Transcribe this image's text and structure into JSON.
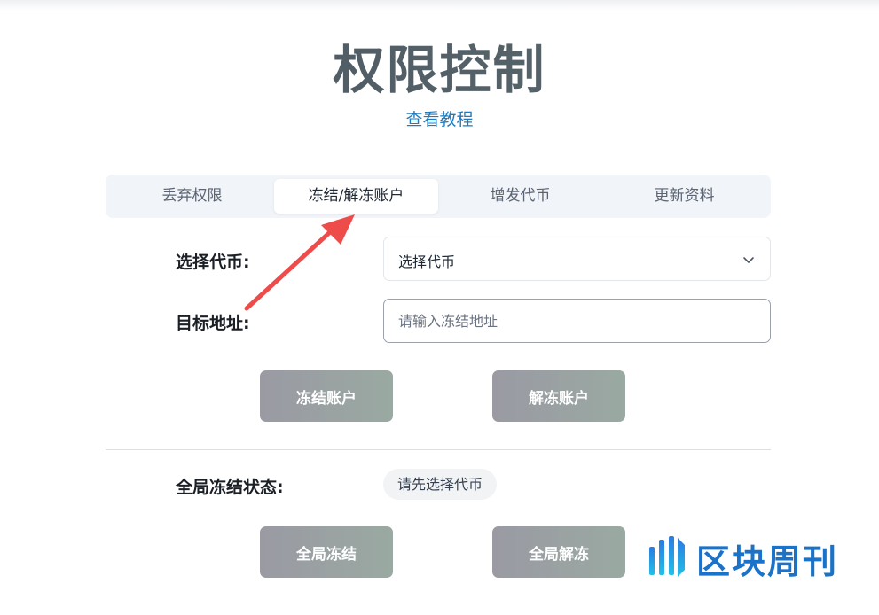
{
  "page": {
    "title": "权限控制",
    "tutorial_link": "查看教程"
  },
  "tabs": [
    {
      "label": "丢弃权限",
      "active": false
    },
    {
      "label": "冻结/解冻账户",
      "active": true
    },
    {
      "label": "增发代币",
      "active": false
    },
    {
      "label": "更新资料",
      "active": false
    }
  ],
  "form": {
    "token_label": "选择代币:",
    "token_select_value": "选择代币",
    "address_label": "目标地址:",
    "address_placeholder": "请输入冻结地址",
    "address_value": ""
  },
  "actions": {
    "freeze_label": "冻结账户",
    "unfreeze_label": "解冻账户"
  },
  "global": {
    "status_label": "全局冻结状态:",
    "status_value": "请先选择代币",
    "freeze_all_label": "全局冻结",
    "unfreeze_all_label": "全局解冻"
  },
  "watermark": {
    "text": "区块周刊"
  },
  "icons": {
    "select_chevron": "chevron-down-icon",
    "annotation_arrow": "arrow-icon"
  },
  "colors": {
    "link": "#1f7bbf",
    "annotation_arrow": "#ee4b4b",
    "watermark": "#1a73c9"
  }
}
